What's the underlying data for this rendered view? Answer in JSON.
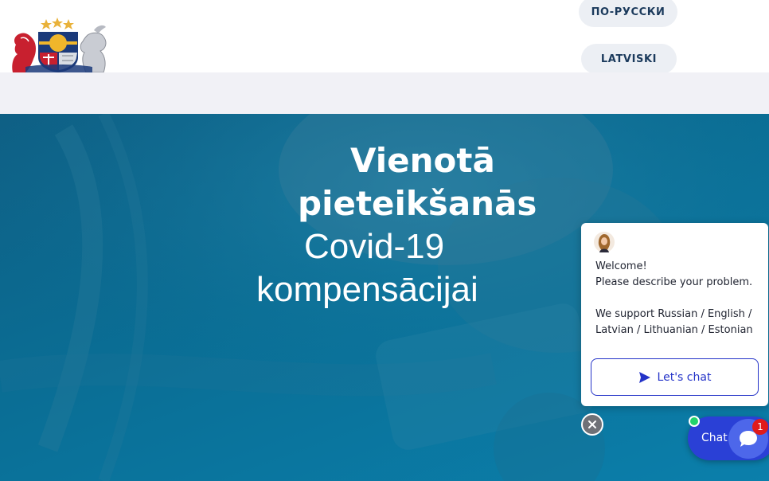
{
  "header": {
    "coat_of_arms_icon": "latvia-coat-of-arms",
    "languages": [
      "ПО-РУССКИ",
      "LATVISKI"
    ]
  },
  "hero": {
    "title_bold": [
      "Vienotā",
      "pieteikšanās"
    ],
    "title_thin": [
      "Covid-19",
      "kompensācijai"
    ]
  },
  "chat_widget": {
    "agent_icon": "agent-avatar",
    "message": "Welcome!\nPlease describe your problem.\n\nWe support Russian / English / Latvian / Lithuanian / Estonian",
    "cta_label": "Let's chat",
    "cta_icon": "send-icon",
    "close_icon": "close-icon",
    "launcher_label": "Chat",
    "launcher_icon": "chat-bubble-icon",
    "unread_count": "1",
    "online_status": "online"
  },
  "colors": {
    "hero": "#0a6e95",
    "subbar": "#f1f1f6",
    "language_button": "#eceff4",
    "chat_accent": "#2433c8",
    "launcher": "#2a40d6",
    "badge": "#e01b1b",
    "online": "#22d36b"
  }
}
